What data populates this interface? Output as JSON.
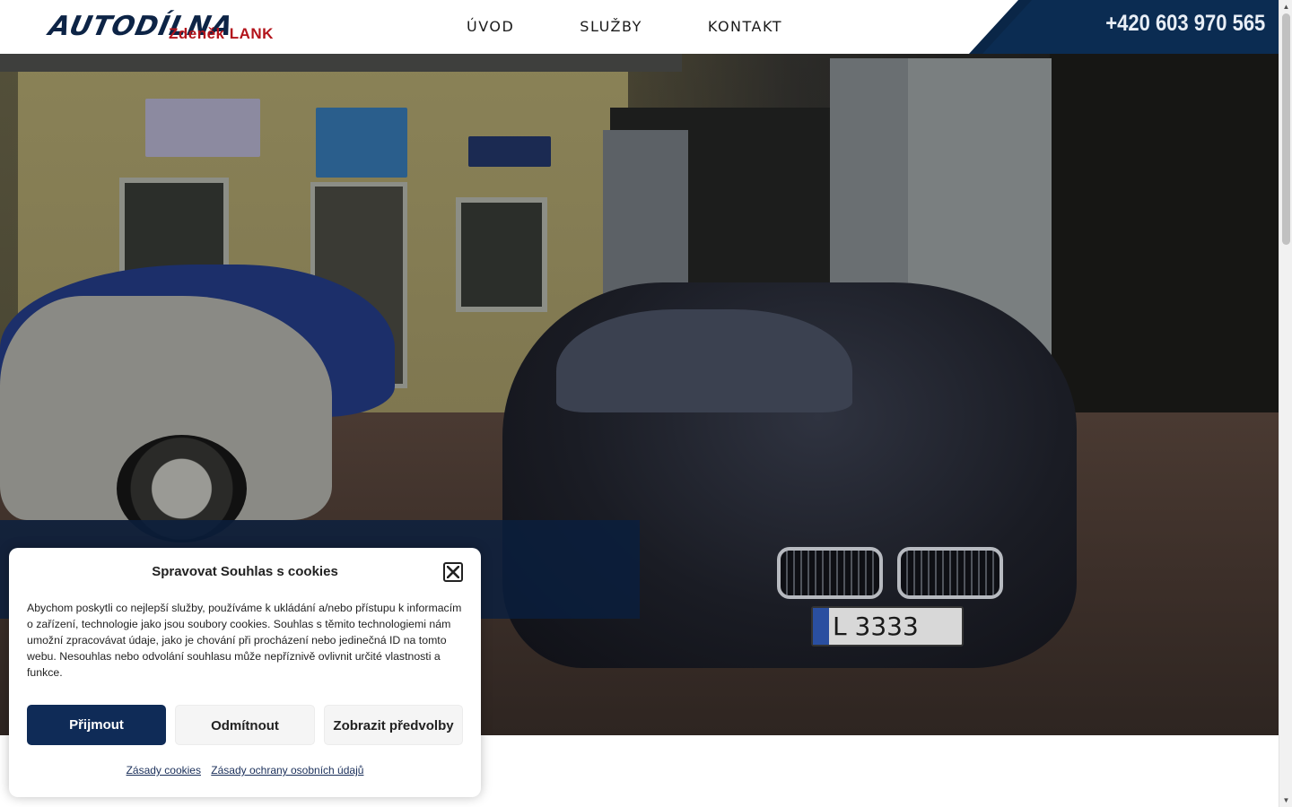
{
  "header": {
    "logo_main": "AUTODÍLNA",
    "logo_sub": "Zdeněk LANK",
    "nav": [
      {
        "label": "ÚVOD"
      },
      {
        "label": "SLUŽBY"
      },
      {
        "label": "KONTAKT"
      }
    ],
    "phone": "+420 603 970 565",
    "colors": {
      "brand": "#0a2647",
      "accent": "#b3141b"
    }
  },
  "hero": {
    "plate_text": "L 3333",
    "plate_country": "CZ"
  },
  "cookie_modal": {
    "title": "Spravovat Souhlas s cookies",
    "body": "Abychom poskytli co nejlepší služby, používáme k ukládání a/nebo přístupu k informacím o zařízení, technologie jako jsou soubory cookies. Souhlas s těmito technologiemi nám umožní zpracovávat údaje, jako je chování při procházení nebo jedinečná ID na tomto webu. Nesouhlas nebo odvolání souhlasu může nepříznivě ovlivnit určité vlastnosti a funkce.",
    "buttons": {
      "accept": "Přijmout",
      "deny": "Odmítnout",
      "preferences": "Zobrazit předvolby"
    },
    "links": {
      "cookie_policy": "Zásady cookies",
      "privacy_policy": "Zásady ochrany osobních údajů"
    },
    "close_icon": "close-icon"
  }
}
